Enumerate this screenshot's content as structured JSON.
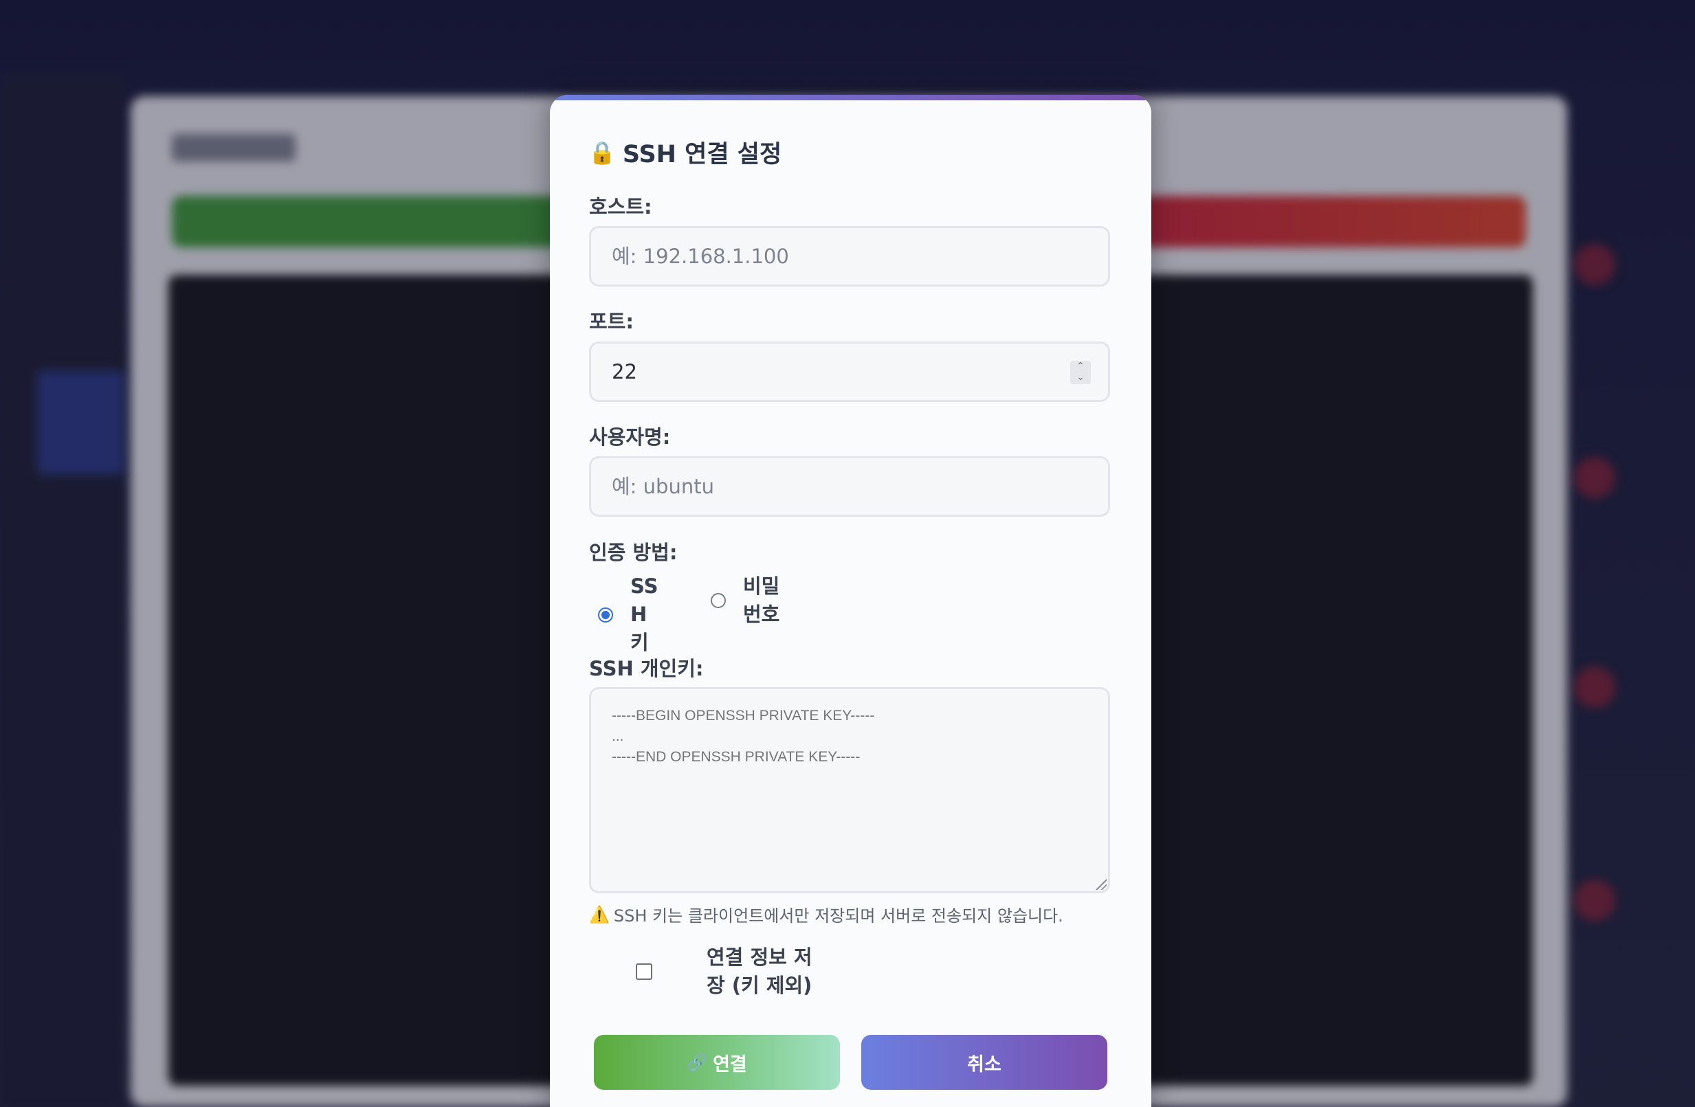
{
  "modal": {
    "title": "SSH 연결 설정",
    "title_icon": "lock-icon",
    "host": {
      "label": "호스트:",
      "placeholder": "예: 192.168.1.100",
      "value": ""
    },
    "port": {
      "label": "포트:",
      "value": "22"
    },
    "username": {
      "label": "사용자명:",
      "placeholder": "예: ubuntu",
      "value": ""
    },
    "auth": {
      "label": "인증 방법:",
      "options": [
        {
          "label": "SSH 키",
          "checked": true
        },
        {
          "label": "비밀번호",
          "checked": false
        }
      ]
    },
    "private_key": {
      "label": "SSH 개인키:",
      "placeholder": "-----BEGIN OPENSSH PRIVATE KEY-----\n...\n-----END OPENSSH PRIVATE KEY-----"
    },
    "warning": "SSH 키는 클라이언트에서만 저장되며 서버로 전송되지 않습니다.",
    "warning_icon": "warning-icon",
    "save_checkbox": {
      "label": "연결 정보 저장 (키 제외)",
      "checked": false
    },
    "buttons": {
      "connect": "연결",
      "connect_icon": "link-icon",
      "cancel": "취소"
    }
  },
  "colors": {
    "accent_gradient_start": "#6b7fe0",
    "accent_gradient_end": "#7b4fb0",
    "connect_gradient_start": "#5aaa3c",
    "connect_gradient_end": "#a3e2c6",
    "radio_selected": "#2f6fd8"
  }
}
